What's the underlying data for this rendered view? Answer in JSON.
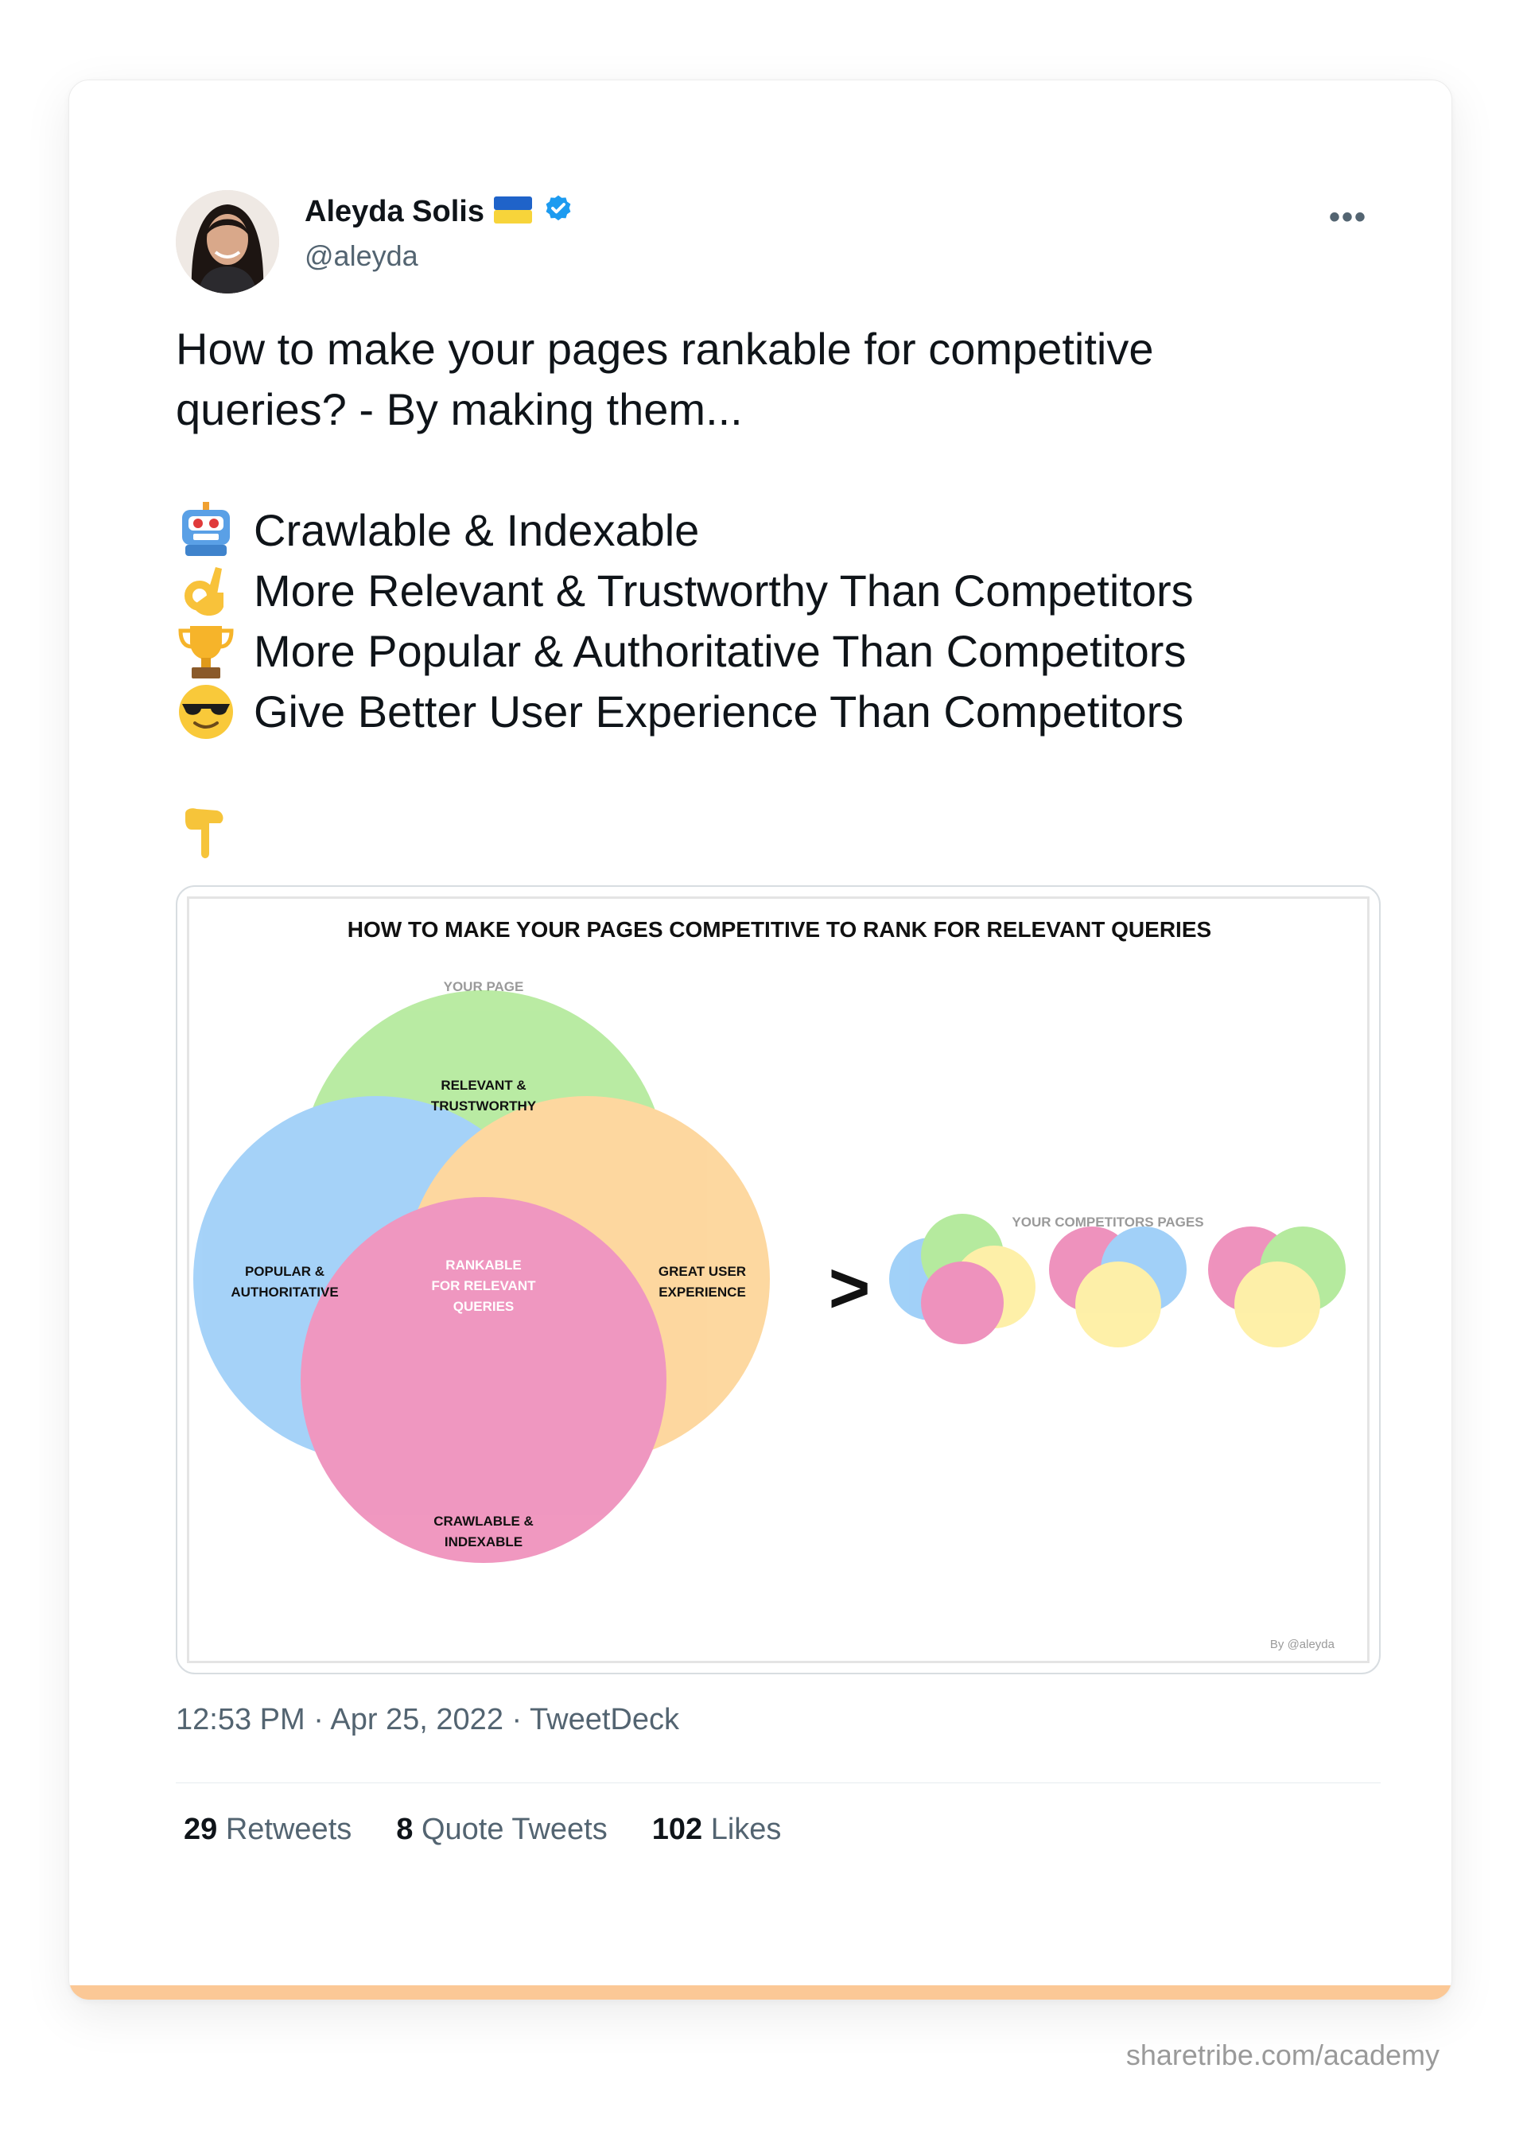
{
  "author": {
    "name": "Aleyda Solis",
    "handle": "@aleyda"
  },
  "menu": {
    "more_label": "•••"
  },
  "tweet": {
    "intro_line1": "How to make your pages rankable for competitive",
    "intro_line2": "queries? - By making them...",
    "items": [
      {
        "icon": "robot-icon",
        "text": "Crawlable & Indexable"
      },
      {
        "icon": "ok-hand-icon",
        "text": "More Relevant & Trustworthy Than Competitors"
      },
      {
        "icon": "trophy-icon",
        "text": "More Popular & Authoritative Than Competitors"
      },
      {
        "icon": "sunglasses-face-icon",
        "text": "Give Better User Experience Than Competitors"
      }
    ],
    "closing_icon": "point-down-icon"
  },
  "infographic": {
    "title": "HOW TO MAKE YOUR PAGES COMPETITIVE TO RANK FOR RELEVANT QUERIES",
    "your_page_label": "YOUR PAGE",
    "relevant_line1": "RELEVANT &",
    "relevant_line2": "TRUSTWORTHY",
    "popular_line1": "POPULAR &",
    "popular_line2": "AUTHORITATIVE",
    "ux_line1": "GREAT USER",
    "ux_line2": "EXPERIENCE",
    "crawl_line1": "CRAWLABLE &",
    "crawl_line2": "INDEXABLE",
    "center_line1": "RANKABLE",
    "center_line2": "FOR RELEVANT",
    "center_line3": "QUERIES",
    "greater_than": ">",
    "competitors_label": "YOUR COMPETITORS PAGES",
    "credit": "By @aleyda",
    "colors": {
      "green": "#8fdf6b",
      "blue": "#6fb8f5",
      "orange": "#fcc066",
      "pink": "#e6589a",
      "yellow": "#fde87a"
    }
  },
  "timestamp": {
    "time": "12:53 PM",
    "date": "Apr 25, 2022",
    "source": "TweetDeck"
  },
  "stats": {
    "retweets_count": "29",
    "retweets_label": "Retweets",
    "quotes_count": "8",
    "quotes_label": "Quote Tweets",
    "likes_count": "102",
    "likes_label": "Likes"
  },
  "watermark": "sharetribe.com/academy"
}
